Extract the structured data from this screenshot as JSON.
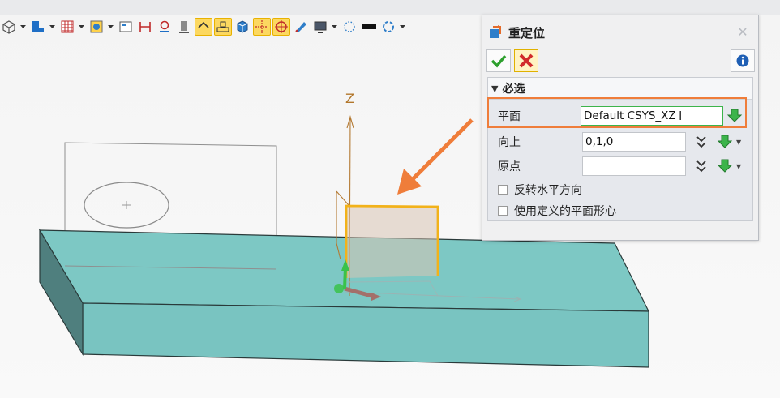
{
  "dialog": {
    "title": "重定位",
    "section_title": "必选",
    "close_symbol": "✕",
    "rows": {
      "plane": {
        "label": "平面",
        "value": "Default CSYS_XZ"
      },
      "up": {
        "label": "向上",
        "value": "0,1,0"
      },
      "origin": {
        "label": "原点",
        "value": ""
      }
    },
    "checkboxes": [
      {
        "label": "反转水平方向",
        "checked": false
      },
      {
        "label": "使用定义的平面形心",
        "checked": false
      }
    ]
  },
  "scene": {
    "axis_label": "Z"
  },
  "colors": {
    "accent_orange": "#ef7d3a",
    "slab_top": "#7dc8c4",
    "slab_front": "#6bbfbc",
    "plane_orange": "#f2b21a",
    "field_green": "#3cb44b"
  },
  "icons": [
    "cube-icon",
    "view-blue-icon",
    "grid-icon",
    "render-icon",
    "frame-icon",
    "dimension-icon",
    "measure-icon",
    "gray-block-icon",
    "select-edge-icon",
    "select-face-icon",
    "blue-cube-icon",
    "snap-grid-icon",
    "target-icon",
    "pen-icon",
    "monitor-icon",
    "dotted-circle-icon",
    "black-rect-icon",
    "rotate-icon",
    "ok-check-icon",
    "cancel-x-icon",
    "info-icon",
    "pick-green-icon",
    "double-chevron-icon",
    "relocate-icon"
  ]
}
